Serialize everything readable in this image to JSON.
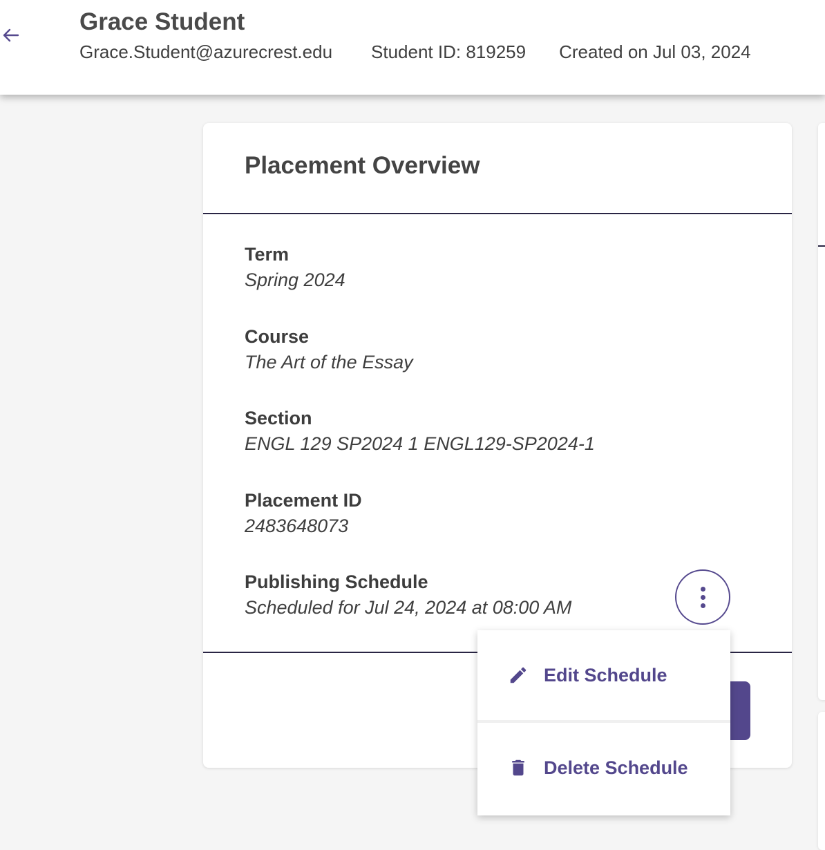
{
  "header": {
    "student_name": "Grace Student",
    "email": "Grace.Student@azurecrest.edu",
    "student_id": "Student ID: 819259",
    "created_on": "Created on Jul 03, 2024"
  },
  "card": {
    "title": "Placement Overview",
    "fields": [
      {
        "label": "Term",
        "value": "Spring 2024"
      },
      {
        "label": "Course",
        "value": "The Art of the Essay"
      },
      {
        "label": "Section",
        "value": "ENGL 129 SP2024 1 ENGL129-SP2024-1"
      },
      {
        "label": "Placement ID",
        "value": "2483648073"
      },
      {
        "label": "Publishing Schedule",
        "value": "Scheduled for Jul 24, 2024 at 08:00 AM"
      }
    ]
  },
  "menu": {
    "items": [
      {
        "label": "Edit Schedule",
        "icon": "pencil-icon"
      },
      {
        "label": "Delete Schedule",
        "icon": "trash-icon"
      }
    ]
  },
  "colors": {
    "accent": "#53478c",
    "divider": "#2a2544",
    "text": "#3f3f3f",
    "background": "#f5f5f5"
  }
}
